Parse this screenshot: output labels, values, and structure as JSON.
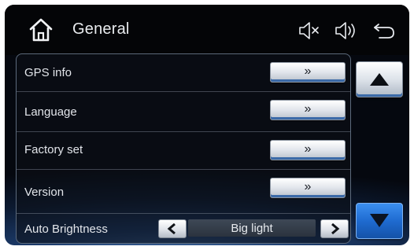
{
  "header": {
    "title": "General",
    "icons": [
      "home-icon",
      "mute-icon",
      "volume-icon",
      "back-icon"
    ]
  },
  "menu": {
    "items": [
      {
        "label": "GPS info",
        "action": "»"
      },
      {
        "label": "Language",
        "action": "»"
      },
      {
        "label": "Factory set",
        "action": "»"
      },
      {
        "label": "Version",
        "action": "»"
      }
    ],
    "brightness": {
      "label": "Auto Brightness",
      "value": "Big light",
      "prev_icon": "chevron-left-icon",
      "next_icon": "chevron-right-icon"
    }
  },
  "scroll": {
    "up_icon": "triangle-up-icon",
    "down_icon": "triangle-down-icon"
  },
  "colors": {
    "accent_blue": "#1f6bd0",
    "header_bg": "#040507",
    "text": "#e2e5ea"
  }
}
